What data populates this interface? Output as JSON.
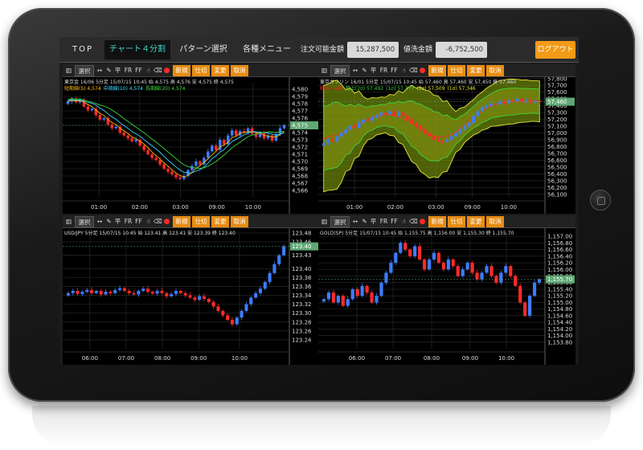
{
  "nav": {
    "top": "TOP",
    "chart4": "チャート４分割",
    "pattern": "パターン選択",
    "menu": "各種メニュー",
    "order_label": "注文可能金額",
    "order_value": "15,287,500",
    "wash_label": "値洗金額",
    "wash_value": "-6,752,500",
    "logout": "ログアウト"
  },
  "toolbar": {
    "select": "選択",
    "flat": "平",
    "fr": "FR",
    "ff": "FF",
    "new": "新規",
    "close": "仕切",
    "modify": "変更",
    "cancel": "取消"
  },
  "colors": {
    "up": "#3d7dff",
    "down": "#ff2a2a",
    "short_ma": "#ffb000",
    "mid_ma": "#35d6ff",
    "long_ma": "#3bd43b",
    "price_tag": "#5fa874",
    "bb_fill": "#6f8a0a",
    "bb_line": "#e6e63a"
  },
  "panels": [
    {
      "id": "gold-tokyo",
      "info": "東京金 16/06 5分足 15/07/15 10:45 始 4,575 高 4,576 安 4,575 終 4,575",
      "legend": [
        {
          "text": "短期線(5) 4,574",
          "color": "#ffb000"
        },
        {
          "text": "中期線(10) 4,574",
          "color": "#35d6ff"
        },
        {
          "text": "長期線(20) 4,574",
          "color": "#3bd43b"
        }
      ],
      "price_tag": "4,575",
      "chart_data": {
        "type": "candlestick",
        "ylim": [
          4565,
          4581
        ],
        "yticks": [
          "4,580",
          "4,579",
          "4,578",
          "4,577",
          "4,576",
          "4,575",
          "4,574",
          "4,573",
          "4,572",
          "4,571",
          "4,570",
          "4,569",
          "4,568",
          "4,567",
          "4,566"
        ],
        "ytick_values": [
          4580,
          4579,
          4578,
          4577,
          4576,
          4575,
          4574,
          4573,
          4572,
          4571,
          4570,
          4569,
          4568,
          4567,
          4566
        ],
        "xticks": [
          "01:00",
          "02:00",
          "03:00",
          "09:00",
          "10:00"
        ],
        "xtick_pos": [
          0.16,
          0.34,
          0.52,
          0.68,
          0.84
        ],
        "closes": [
          4578.3,
          4578.6,
          4578.2,
          4578.5,
          4577.6,
          4577.1,
          4577.3,
          4576.4,
          4575.8,
          4576.0,
          4575.1,
          4574.6,
          4574.8,
          4574.0,
          4573.6,
          4573.2,
          4572.8,
          4573.0,
          4572.2,
          4571.6,
          4571.0,
          4570.5,
          4570.2,
          4569.6,
          4569.0,
          4568.6,
          4568.2,
          4567.8,
          4567.6,
          4568.0,
          4568.8,
          4569.4,
          4570.0,
          4569.6,
          4570.5,
          4571.4,
          4572.2,
          4571.6,
          4573.0,
          4572.4,
          4573.6,
          4574.3,
          4573.6,
          4574.2,
          4574.0,
          4574.6,
          4573.8,
          4573.4,
          4574.0,
          4573.2,
          4573.6,
          4572.9,
          4573.8,
          4574.6,
          4575.0
        ],
        "overlays": [
          {
            "name": "短期線(5)",
            "color": "#ffb000",
            "shift": 0.0
          },
          {
            "name": "中期線(10)",
            "color": "#35d6ff",
            "shift": 0.4
          },
          {
            "name": "長期線(20)",
            "color": "#3bd43b",
            "shift": 0.9
          }
        ]
      }
    },
    {
      "id": "gasoline-tokyo",
      "info": "東京ガソリン 16/01 5分足 15/07/15 10:45 始 57,460 高 57,460 安 57,450 終 57,460",
      "legend": [
        {
          "text": "線 57,428",
          "color": "#ff2a2a"
        },
        {
          "text": "幅上(2σ) 57,492",
          "color": "#3bd43b"
        },
        {
          "text": "(1σ) 57,373",
          "color": "#3bd43b"
        },
        {
          "text": "(3σ) 57,509",
          "color": "#e6e63a"
        },
        {
          "text": "(1σ) 57,346",
          "color": "#e6e63a"
        }
      ],
      "price_tag": "57,460",
      "chart_data": {
        "type": "candlestick",
        "ylim": [
          56050,
          57750
        ],
        "yticks": [
          "57,800",
          "57,700",
          "57,600",
          "57,500",
          "57,400",
          "57,300",
          "57,200",
          "57,100",
          "57,000",
          "56,900",
          "56,800",
          "56,700",
          "56,600",
          "56,500",
          "56,400",
          "56,300",
          "56,200",
          "56,100"
        ],
        "ytick_values": [
          57800,
          57700,
          57600,
          57500,
          57400,
          57300,
          57200,
          57100,
          57000,
          56900,
          56800,
          56700,
          56600,
          56500,
          56400,
          56300,
          56200,
          56100
        ],
        "xticks": [
          "01:00",
          "02:00",
          "03:00",
          "09:00",
          "10:00"
        ],
        "xtick_pos": [
          0.16,
          0.34,
          0.52,
          0.68,
          0.84
        ],
        "closes": [
          56850,
          56900,
          56880,
          56950,
          57000,
          57050,
          57100,
          57080,
          57150,
          57200,
          57180,
          57230,
          57260,
          57300,
          57280,
          57320,
          57260,
          57300,
          57250,
          57200,
          57150,
          57100,
          57050,
          57000,
          56950,
          56900,
          56880,
          56870,
          56900,
          56950,
          57000,
          57050,
          57100,
          57150,
          57250,
          57320,
          57380,
          57400,
          57430,
          57420,
          57460,
          57440,
          57480,
          57470,
          57500,
          57460,
          57480,
          57450,
          57470,
          57460
        ],
        "band": {
          "width": [
            780,
            800,
            720,
            600,
            480,
            360,
            300,
            270,
            260,
            300,
            380,
            480,
            560,
            620,
            640,
            600,
            520,
            400,
            300,
            260,
            260,
            280,
            300,
            320,
            330,
            330,
            320,
            310,
            300,
            300
          ],
          "mid_color": "#ff2a2a"
        }
      }
    },
    {
      "id": "usdjpy",
      "info": "USD/JPY 5分足 15/07/15 10:45 始 123.41 高 123.41 安 123.39 終 123.40",
      "legend": [],
      "price_tag": "123.40",
      "chart_data": {
        "type": "candlestick",
        "ylim": [
          123.22,
          123.48
        ],
        "yticks": [
          "123.48",
          "123.46",
          "123.43",
          "123.40",
          "123.38",
          "123.36",
          "123.34",
          "123.32",
          "123.30",
          "123.28",
          "123.26",
          "123.24"
        ],
        "ytick_values": [
          123.48,
          123.46,
          123.43,
          123.4,
          123.38,
          123.36,
          123.34,
          123.32,
          123.3,
          123.28,
          123.26,
          123.24
        ],
        "xticks": [
          "06:00",
          "07:00",
          "08:00",
          "09:00",
          "10:00"
        ],
        "xtick_pos": [
          0.12,
          0.28,
          0.44,
          0.6,
          0.78
        ],
        "closes": [
          123.345,
          123.35,
          123.343,
          123.348,
          123.352,
          123.345,
          123.35,
          123.342,
          123.348,
          123.345,
          123.352,
          123.356,
          123.35,
          123.345,
          123.342,
          123.35,
          123.355,
          123.348,
          123.344,
          123.35,
          123.345,
          123.338,
          123.343,
          123.35,
          123.345,
          123.34,
          123.335,
          123.33,
          123.338,
          123.332,
          123.325,
          123.315,
          123.305,
          123.295,
          123.285,
          123.275,
          123.29,
          123.305,
          123.32,
          123.335,
          123.345,
          123.355,
          123.37,
          123.39,
          123.41,
          123.43,
          123.45
        ],
        "overlays": []
      }
    },
    {
      "id": "gold-sp",
      "info": "GOLD(SP) 5分足 15/07/15 10:45 始 1,155.75 高 1,156.00 安 1,155.30 終 1,155.70",
      "legend": [],
      "price_tag": "1,155.70",
      "chart_data": {
        "type": "candlestick",
        "ylim": [
          1153.6,
          1157.1
        ],
        "yticks": [
          "1,157.00",
          "1,156.80",
          "1,156.60",
          "1,156.40",
          "1,156.20",
          "1,156.00",
          "1,155.80",
          "1,155.60",
          "1,155.40",
          "1,155.20",
          "1,155.00",
          "1,154.80",
          "1,154.60",
          "1,154.40",
          "1,154.20",
          "1,154.00",
          "1,153.80"
        ],
        "ytick_values": [
          1157.0,
          1156.8,
          1156.6,
          1156.4,
          1156.2,
          1156.0,
          1155.8,
          1155.6,
          1155.4,
          1155.2,
          1155.0,
          1154.8,
          1154.6,
          1154.4,
          1154.2,
          1154.0,
          1153.8
        ],
        "xticks": [
          "06:00",
          "07:00",
          "08:00",
          "09:00",
          "10:00"
        ],
        "xtick_pos": [
          0.17,
          0.33,
          0.5,
          0.67,
          0.83
        ],
        "closes": [
          1155.1,
          1155.3,
          1155.0,
          1155.2,
          1154.9,
          1155.1,
          1155.4,
          1155.2,
          1155.5,
          1155.3,
          1155.0,
          1155.2,
          1155.6,
          1155.9,
          1156.2,
          1156.5,
          1156.8,
          1156.6,
          1156.4,
          1156.7,
          1156.3,
          1156.0,
          1156.3,
          1156.5,
          1156.2,
          1156.0,
          1156.3,
          1156.1,
          1155.8,
          1156.0,
          1156.2,
          1155.9,
          1155.7,
          1155.9,
          1156.1,
          1155.8,
          1155.6,
          1155.9,
          1156.1,
          1155.8,
          1155.5,
          1155.0,
          1154.6,
          1155.2,
          1155.6,
          1155.7
        ],
        "overlays": []
      }
    }
  ]
}
